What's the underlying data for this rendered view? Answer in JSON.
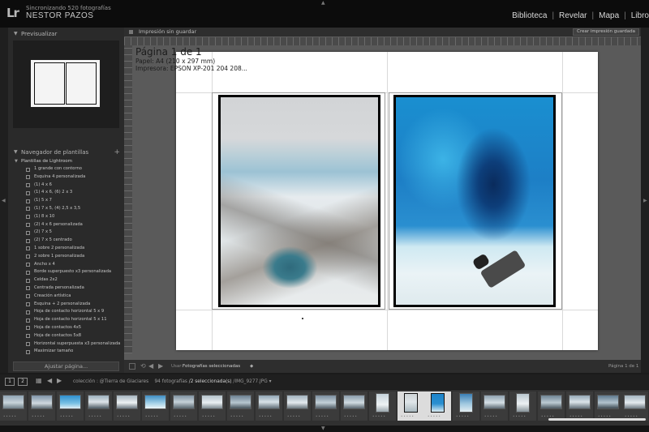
{
  "identity": {
    "logo": "Lr",
    "sync_status": "Sincronizando 520 fotografías",
    "user": "NESTOR PAZOS"
  },
  "modules": [
    "Biblioteca",
    "Revelar",
    "Mapa",
    "Libro"
  ],
  "left_panel": {
    "preview_title": "Previsualizar",
    "template_browser_title": "Navegador de plantillas",
    "template_root": "Plantillas de Lightroom",
    "templates": [
      "1 grande con contorno",
      "Esquina 4 personalizada",
      "(1) 4 x 6",
      "(1) 4 x 6, (6) 2 x 3",
      "(1) 5 x 7",
      "(1) 7 x 5, (4) 2,5 x 3,5",
      "(1) 8 x 10",
      "(2) 4 x 6 personalizada",
      "(2) 7 x 5",
      "(2) 7 x 5 centrado",
      "1 sobre 2 personalizada",
      "2 sobre 1 personalizada",
      "Ancho x 4",
      "Borde superpuesto x3 personalizada",
      "Celdas 2x2",
      "Centrada personalizada",
      "Creación artística",
      "Esquina + 2 personalizada",
      "Hoja de contacto horizontal 5 x 9",
      "Hoja de contacto horizontal 5 x 11",
      "Hoja de contactos 4x5",
      "Hoja de contactos 5x8",
      "Horizontal superpuesta x3 personalizada",
      "Maximizar tamaño"
    ],
    "fit_button": "Ajustar página..."
  },
  "center": {
    "header_label": "Impresión sin guardar",
    "save_button": "Crear impresión guardada",
    "page_title": "Página 1 de 1",
    "paper_line": "Papel: A4 (210 x 297 mm)",
    "printer_line": "Impresora: EPSON XP-201 204 208...",
    "toolbar_use_label": "Usar:",
    "toolbar_use_value": "Fotografías seleccionadas",
    "page_counter": "Página 1 de 1"
  },
  "filmstrip": {
    "screen_1": "1",
    "screen_2": "2",
    "collection_label": "colección : @Tierra de Glaciares",
    "photo_count": "94 fotografías",
    "selection_info": "/2 seleccionada(s)",
    "file_name": "/IMG_9277.JPG"
  }
}
